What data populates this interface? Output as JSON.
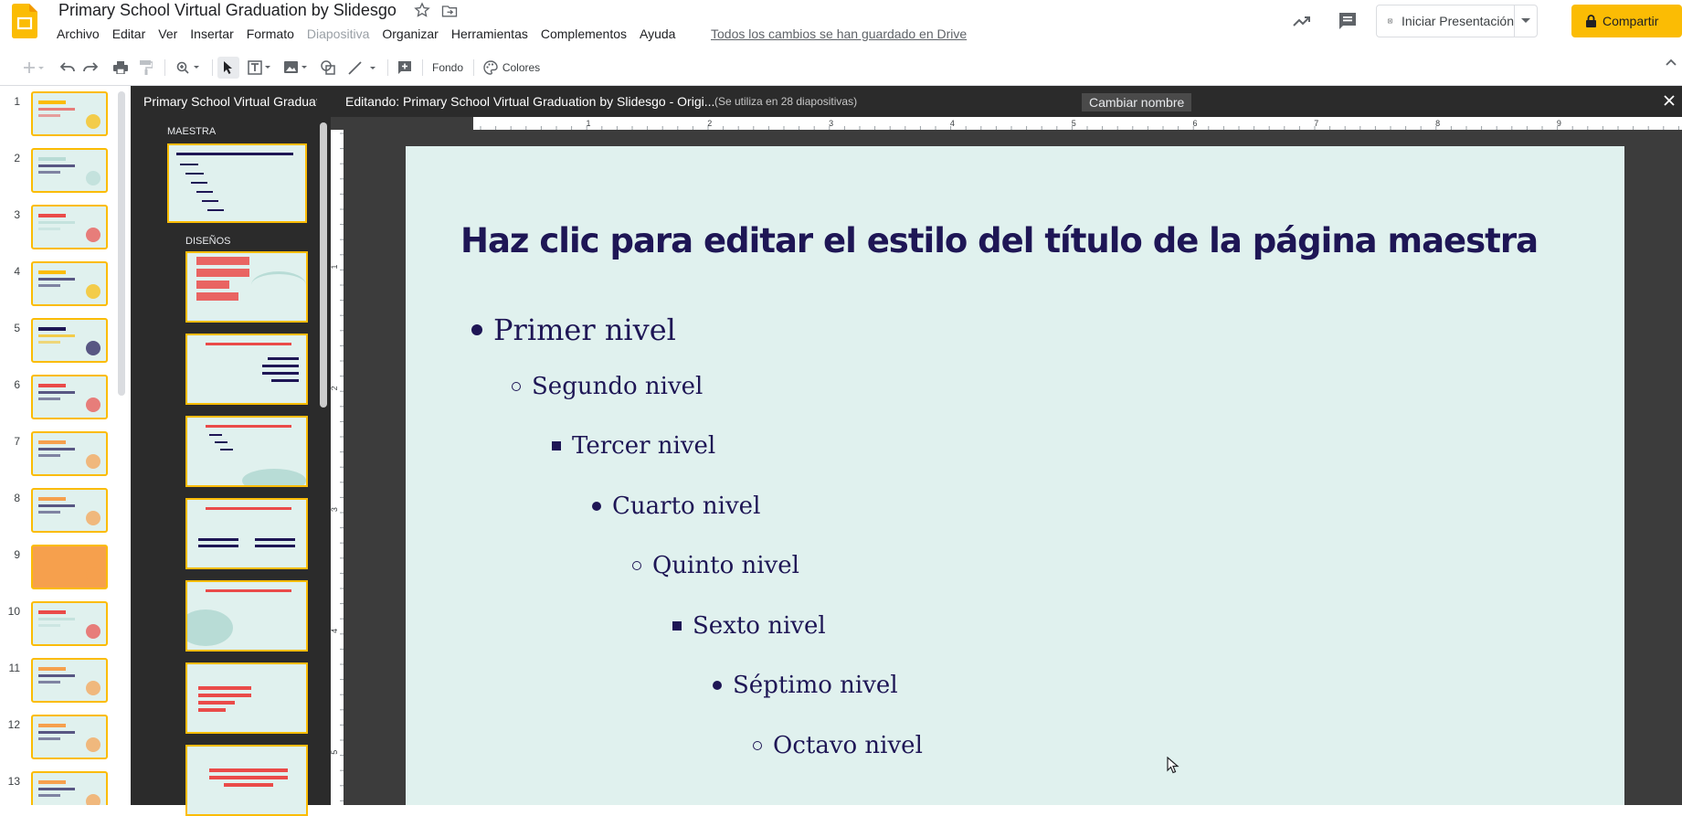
{
  "app": {
    "doc_title": "Primary School Virtual Graduation by Slidesgo",
    "save_status": "Todos los cambios se han guardado en Drive",
    "menu": [
      {
        "label": "Archivo",
        "disabled": false
      },
      {
        "label": "Editar",
        "disabled": false
      },
      {
        "label": "Ver",
        "disabled": false
      },
      {
        "label": "Insertar",
        "disabled": false
      },
      {
        "label": "Formato",
        "disabled": false
      },
      {
        "label": "Diapositiva",
        "disabled": true
      },
      {
        "label": "Organizar",
        "disabled": false
      },
      {
        "label": "Herramientas",
        "disabled": false
      },
      {
        "label": "Complementos",
        "disabled": false
      },
      {
        "label": "Ayuda",
        "disabled": false
      }
    ],
    "present_label": "Iniciar Presentación",
    "share_label": "Compartir",
    "accent_color": "#fbbc04"
  },
  "toolbar": {
    "background_label": "Fondo",
    "colors_label": "Colores"
  },
  "filmstrip": {
    "slides": [
      "1",
      "2",
      "3",
      "4",
      "5",
      "6",
      "7",
      "8",
      "9",
      "10",
      "11",
      "12",
      "13"
    ]
  },
  "layout_panel": {
    "title": "Primary School Virtual Graduation by Slidesgo",
    "master_label": "MAESTRA",
    "layouts_label": "DISEÑOS"
  },
  "master_editor": {
    "editing_label": "Editando: Primary School Virtual Graduation by Slidesgo - Origi...",
    "usage_note": "(Se utiliza en 28 diapositivas)",
    "rename_label": "Cambiar nombre",
    "ruler_h": [
      "1",
      "2",
      "3",
      "4",
      "5",
      "6",
      "7",
      "8",
      "9"
    ],
    "ruler_v": [
      "1",
      "2",
      "3",
      "4",
      "5"
    ]
  },
  "slide": {
    "title": "Haz clic para editar el estilo del título de la página maestra",
    "levels": [
      {
        "text": "Primer nivel",
        "bullet": "disc"
      },
      {
        "text": "Segundo nivel",
        "bullet": "circle"
      },
      {
        "text": "Tercer nivel",
        "bullet": "square"
      },
      {
        "text": "Cuarto nivel",
        "bullet": "disc"
      },
      {
        "text": "Quinto nivel",
        "bullet": "circle"
      },
      {
        "text": "Sexto nivel",
        "bullet": "square"
      },
      {
        "text": "Séptimo nivel",
        "bullet": "disc"
      },
      {
        "text": "Octavo nivel",
        "bullet": "circle"
      }
    ],
    "background_color": "#e0f1ee",
    "text_color": "#1e1655"
  }
}
